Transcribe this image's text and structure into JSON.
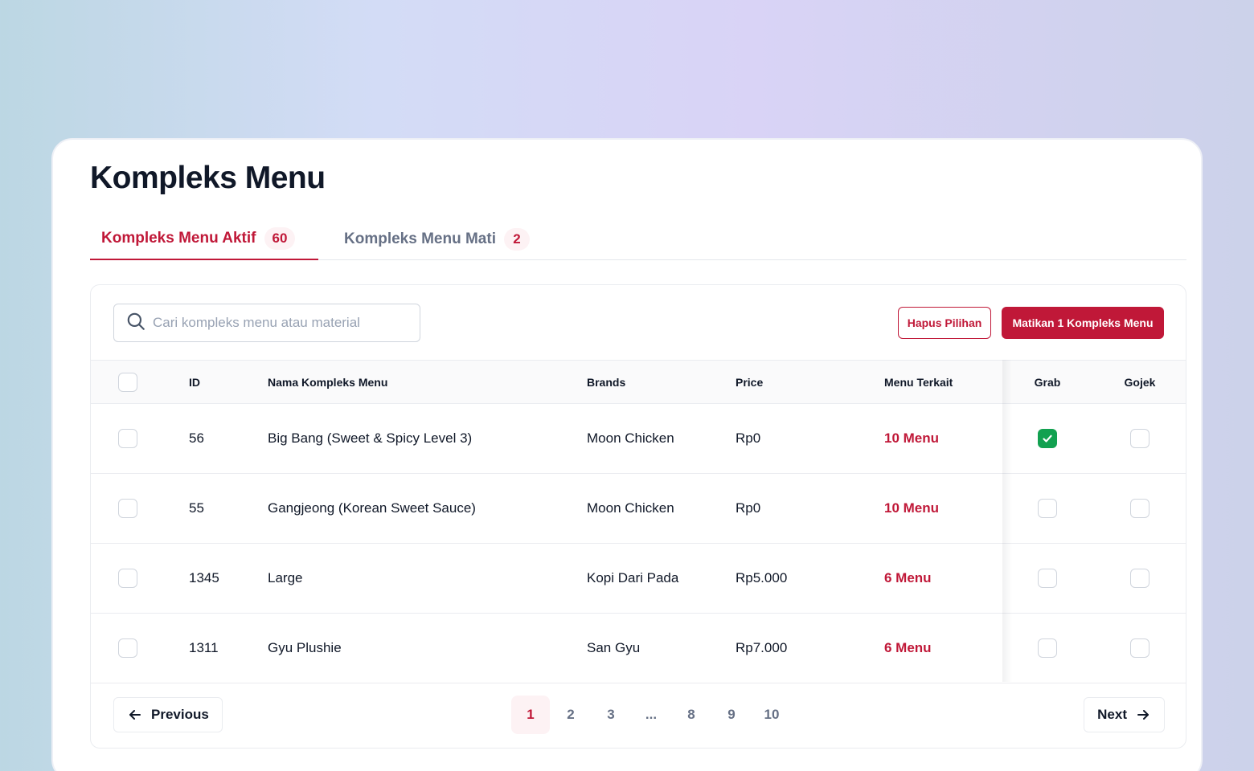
{
  "page": {
    "title": "Kompleks Menu"
  },
  "tabs": [
    {
      "label": "Kompleks Menu Aktif",
      "count": "60",
      "active": true
    },
    {
      "label": "Kompleks Menu Mati",
      "count": "2",
      "active": false
    }
  ],
  "toolbar": {
    "search_placeholder": "Cari kompleks menu atau material",
    "search_value": "",
    "clear_label": "Hapus Pilihan",
    "deactivate_label": "Matikan 1 Kompleks Menu"
  },
  "table": {
    "headers": {
      "id": "ID",
      "name": "Nama Kompleks Menu",
      "brands": "Brands",
      "price": "Price",
      "menu": "Menu Terkait",
      "grab": "Grab",
      "gojek": "Gojek"
    },
    "rows": [
      {
        "selected": false,
        "id": "56",
        "name": "Big Bang (Sweet & Spicy Level 3)",
        "brand": "Moon Chicken",
        "price": "Rp0",
        "menu": "10 Menu",
        "grab": true,
        "gojek": false
      },
      {
        "selected": false,
        "id": "55",
        "name": "Gangjeong (Korean Sweet Sauce)",
        "brand": "Moon Chicken",
        "price": "Rp0",
        "menu": "10 Menu",
        "grab": false,
        "gojek": false
      },
      {
        "selected": false,
        "id": "1345",
        "name": "Large",
        "brand": "Kopi Dari Pada",
        "price": "Rp5.000",
        "menu": "6 Menu",
        "grab": false,
        "gojek": false
      },
      {
        "selected": false,
        "id": "1311",
        "name": "Gyu Plushie",
        "brand": "San Gyu",
        "price": "Rp7.000",
        "menu": "6 Menu",
        "grab": false,
        "gojek": false
      }
    ]
  },
  "pagination": {
    "previous_label": "Previous",
    "next_label": "Next",
    "pages": [
      "1",
      "2",
      "3",
      "...",
      "8",
      "9",
      "10"
    ],
    "current": "1"
  },
  "colors": {
    "accent": "#c01838",
    "check_on": "#12a150",
    "text": "#101828",
    "muted": "#667085"
  },
  "icons": {
    "search": "search-icon",
    "prev": "arrow-left-icon",
    "next": "arrow-right-icon",
    "check": "check-icon"
  }
}
